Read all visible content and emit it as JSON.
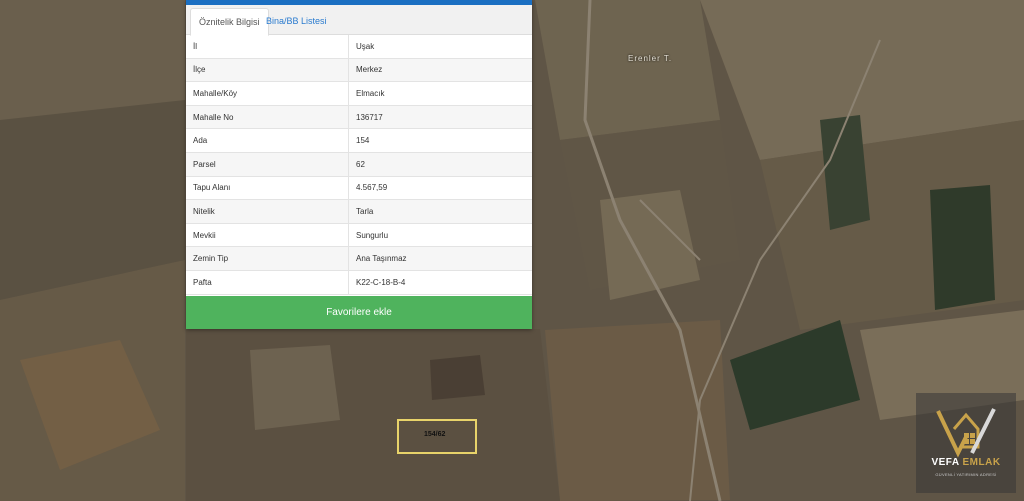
{
  "tabs": [
    {
      "label": "Öznitelik Bilgisi",
      "active": true
    },
    {
      "label": "Bina/BB Listesi",
      "active": false
    }
  ],
  "attributes": [
    {
      "key": "İl",
      "value": "Uşak"
    },
    {
      "key": "İlçe",
      "value": "Merkez"
    },
    {
      "key": "Mahalle/Köy",
      "value": "Elmacık"
    },
    {
      "key": "Mahalle No",
      "value": "136717"
    },
    {
      "key": "Ada",
      "value": "154"
    },
    {
      "key": "Parsel",
      "value": "62"
    },
    {
      "key": "Tapu Alanı",
      "value": "4.567,59"
    },
    {
      "key": "Nitelik",
      "value": "Tarla"
    },
    {
      "key": "Mevkii",
      "value": "Sungurlu"
    },
    {
      "key": "Zemin Tip",
      "value": "Ana Taşınmaz"
    },
    {
      "key": "Pafta",
      "value": "K22-C-18-B-4"
    }
  ],
  "favorite_button": "Favorilere ekle",
  "map": {
    "parcel_label": "154/62",
    "road_label": "Erenler T."
  },
  "logo": {
    "name_part1": "VEFA",
    "name_part2": "EMLAK",
    "tagline": "GÜVENLİ YATIRIMIN ADRESİ"
  },
  "colors": {
    "accent_blue": "#1b6fc2",
    "button_green": "#4fb35d",
    "parcel_outline": "#e8d36a",
    "logo_gold": "#c8a24a"
  }
}
